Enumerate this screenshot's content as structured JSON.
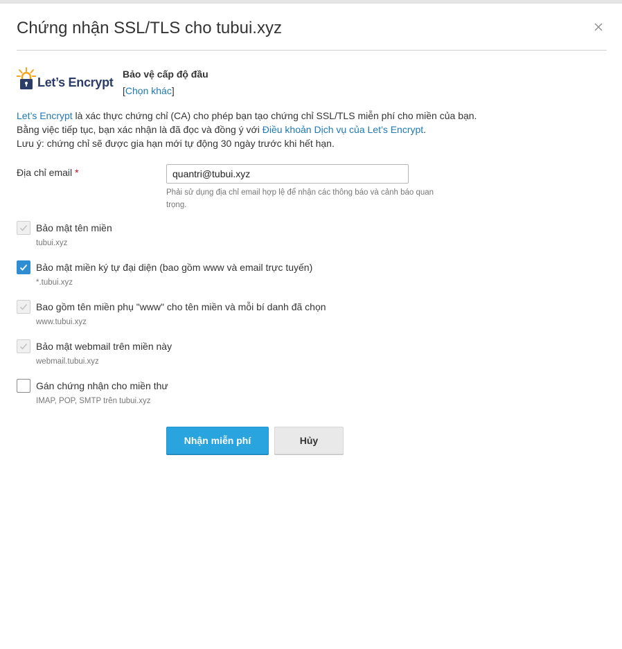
{
  "dialog": {
    "title": "Chứng nhận SSL/TLS cho tubui.xyz",
    "close_icon": "close-icon"
  },
  "provider": {
    "logo_text": "Let’s Encrypt",
    "name": "Bảo vệ cấp độ đầu",
    "change_prefix": "[",
    "change_label": "Chọn khác",
    "change_suffix": "]"
  },
  "description": {
    "line1_link": "Let’s Encrypt",
    "line1_rest": " là xác thực chứng chỉ (CA) cho phép bạn tạo chứng chỉ SSL/TLS miễn phí cho miền của bạn.",
    "line2_prefix": "Bằng việc tiếp tục, bạn xác nhận là đã đọc và đồng ý với ",
    "line2_link": "Điều khoản Dịch vụ của Let’s Encrypt",
    "line2_suffix": ".",
    "line3": "Lưu ý: chứng chỉ sẽ được gia hạn mới tự động 30 ngày trước khi hết hạn."
  },
  "email": {
    "label": "Địa chỉ email",
    "required_mark": "*",
    "value": "quantri@tubui.xyz",
    "hint": "Phải sử dụng địa chỉ email hợp lệ để nhận các thông báo và cảnh báo quan trọng."
  },
  "options": [
    {
      "label": "Bảo mật tên miền",
      "sub": "tubui.xyz",
      "checked": true,
      "disabled": true
    },
    {
      "label": "Bảo mật miền ký tự đại diện (bao gồm www và email trực tuyến)",
      "sub": "*.tubui.xyz",
      "checked": true,
      "disabled": false
    },
    {
      "label": "Bao gồm tên miền phụ \"www\" cho tên miền và mỗi bí danh đã chọn",
      "sub": "www.tubui.xyz",
      "checked": true,
      "disabled": true
    },
    {
      "label": "Bảo mật webmail trên miền này",
      "sub": "webmail.tubui.xyz",
      "checked": true,
      "disabled": true
    },
    {
      "label": "Gán chứng nhận cho miền thư",
      "sub": "IMAP, POP, SMTP trên tubui.xyz",
      "checked": false,
      "disabled": false
    }
  ],
  "buttons": {
    "primary": "Nhận miễn phí",
    "cancel": "Hủy"
  },
  "colors": {
    "accent": "#2aa4df",
    "link": "#1e78b4",
    "logo_navy": "#2c3c69",
    "logo_orange": "#f7a41d",
    "required": "#d0021b"
  }
}
